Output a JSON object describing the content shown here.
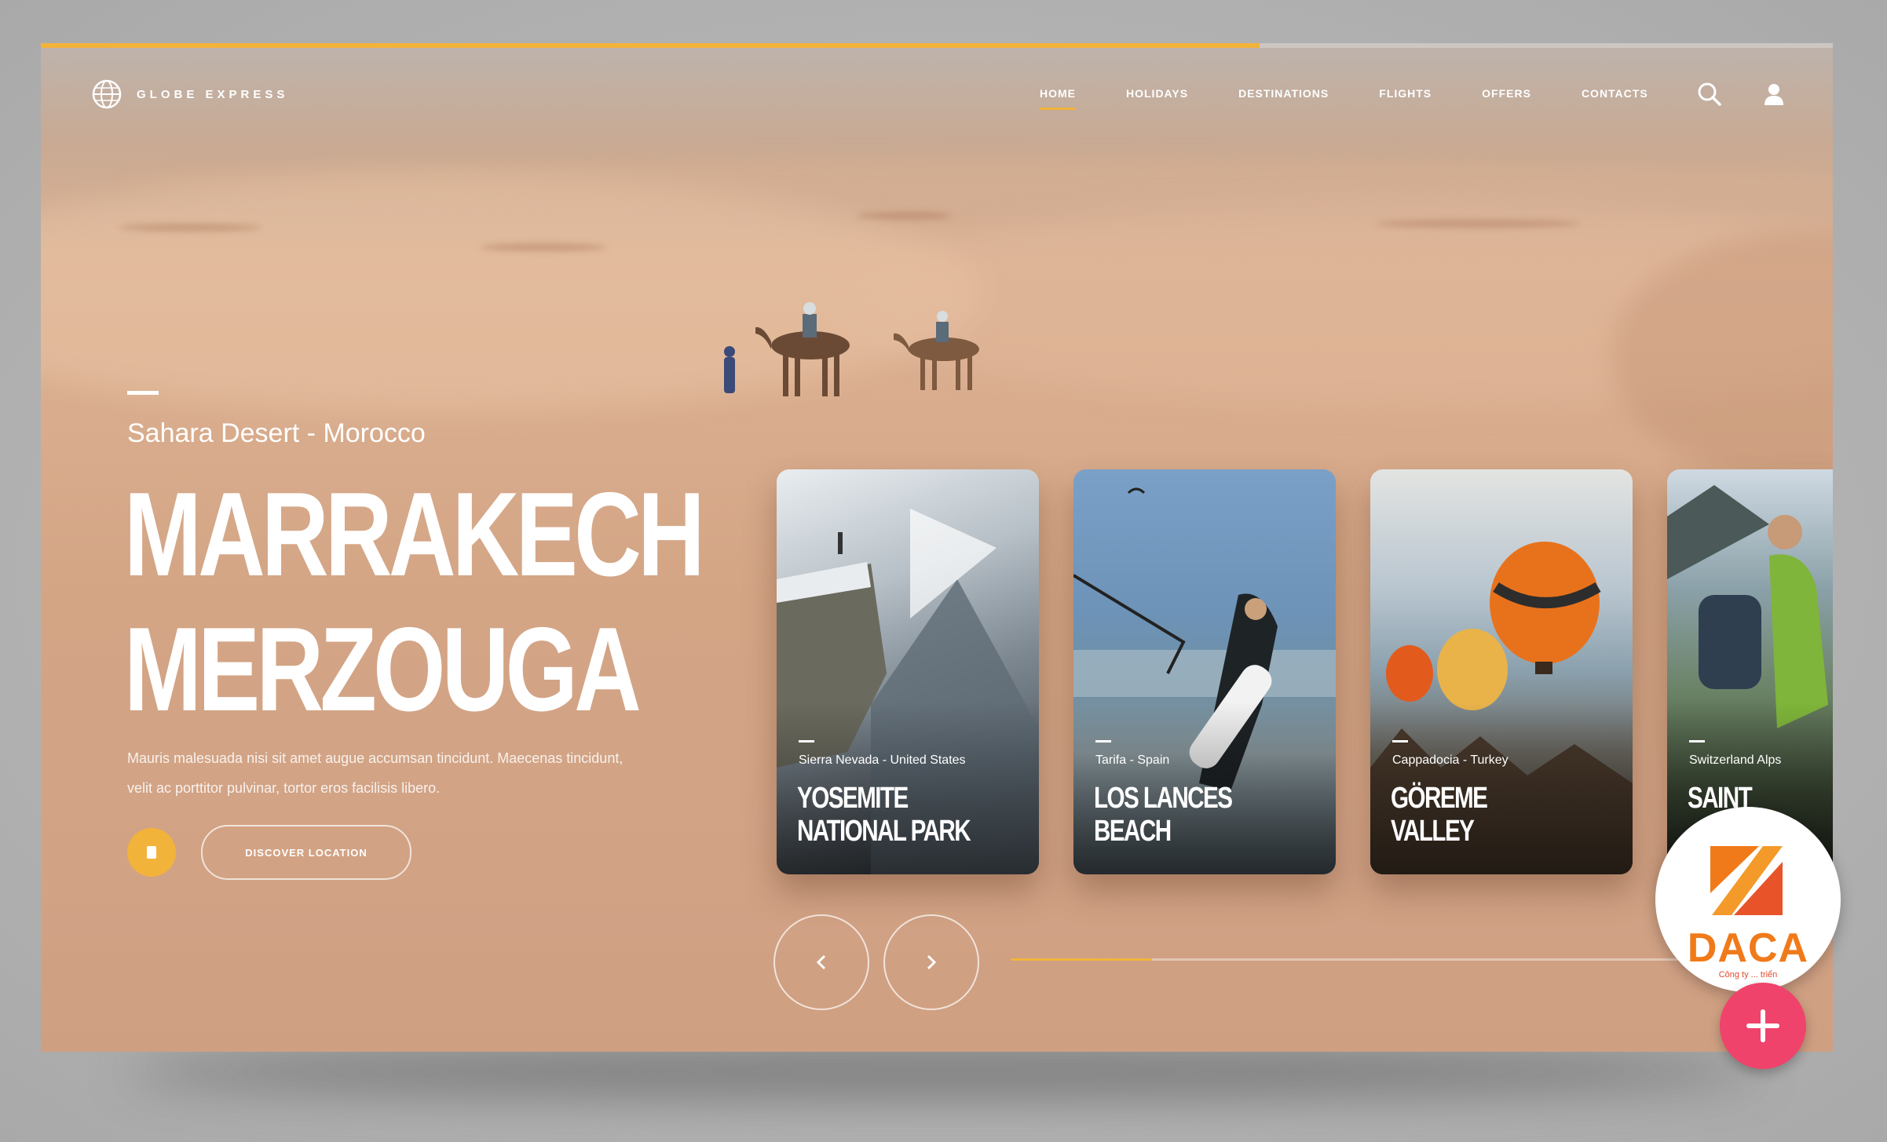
{
  "brand": {
    "name": "GLOBE EXPRESS",
    "icon": "globe-icon"
  },
  "nav": {
    "items": [
      {
        "label": "HOME",
        "active": true
      },
      {
        "label": "HOLIDAYS",
        "active": false
      },
      {
        "label": "DESTINATIONS",
        "active": false
      },
      {
        "label": "FLIGHTS",
        "active": false
      },
      {
        "label": "OFFERS",
        "active": false
      },
      {
        "label": "CONTACTS",
        "active": false
      }
    ],
    "search_icon": "search-icon",
    "user_icon": "user-icon"
  },
  "hero": {
    "subtitle": "Sahara Desert - Morocco",
    "title_line1": "MARRAKECH",
    "title_line2": "MERZOUGA",
    "description": "Mauris malesuada nisi sit amet augue accumsan tincidunt. Maecenas tincidunt, velit ac porttitor pulvinar, tortor eros facilisis libero.",
    "cta_label": "DISCOVER LOCATION"
  },
  "cards": [
    {
      "location": "Sierra Nevada - United States",
      "name_line1": "YOSEMITE",
      "name_line2": "NATIONAL PARK"
    },
    {
      "location": "Tarifa - Spain",
      "name_line1": "LOS LANCES",
      "name_line2": "BEACH"
    },
    {
      "location": "Cappadocia - Turkey",
      "name_line1": "GÖREME",
      "name_line2": "VALLEY"
    },
    {
      "location": "Switzerland Alps",
      "name_line1": "SAINT",
      "name_line2": ""
    }
  ],
  "slider": {
    "progress": 0.2
  },
  "page_progress": 0.68,
  "watermark": {
    "name": "DACA",
    "tagline": "Công ty ... triển"
  },
  "colors": {
    "accent": "#f2b33b",
    "plus_button": "#f0436b",
    "watermark": "#f07a1a"
  }
}
